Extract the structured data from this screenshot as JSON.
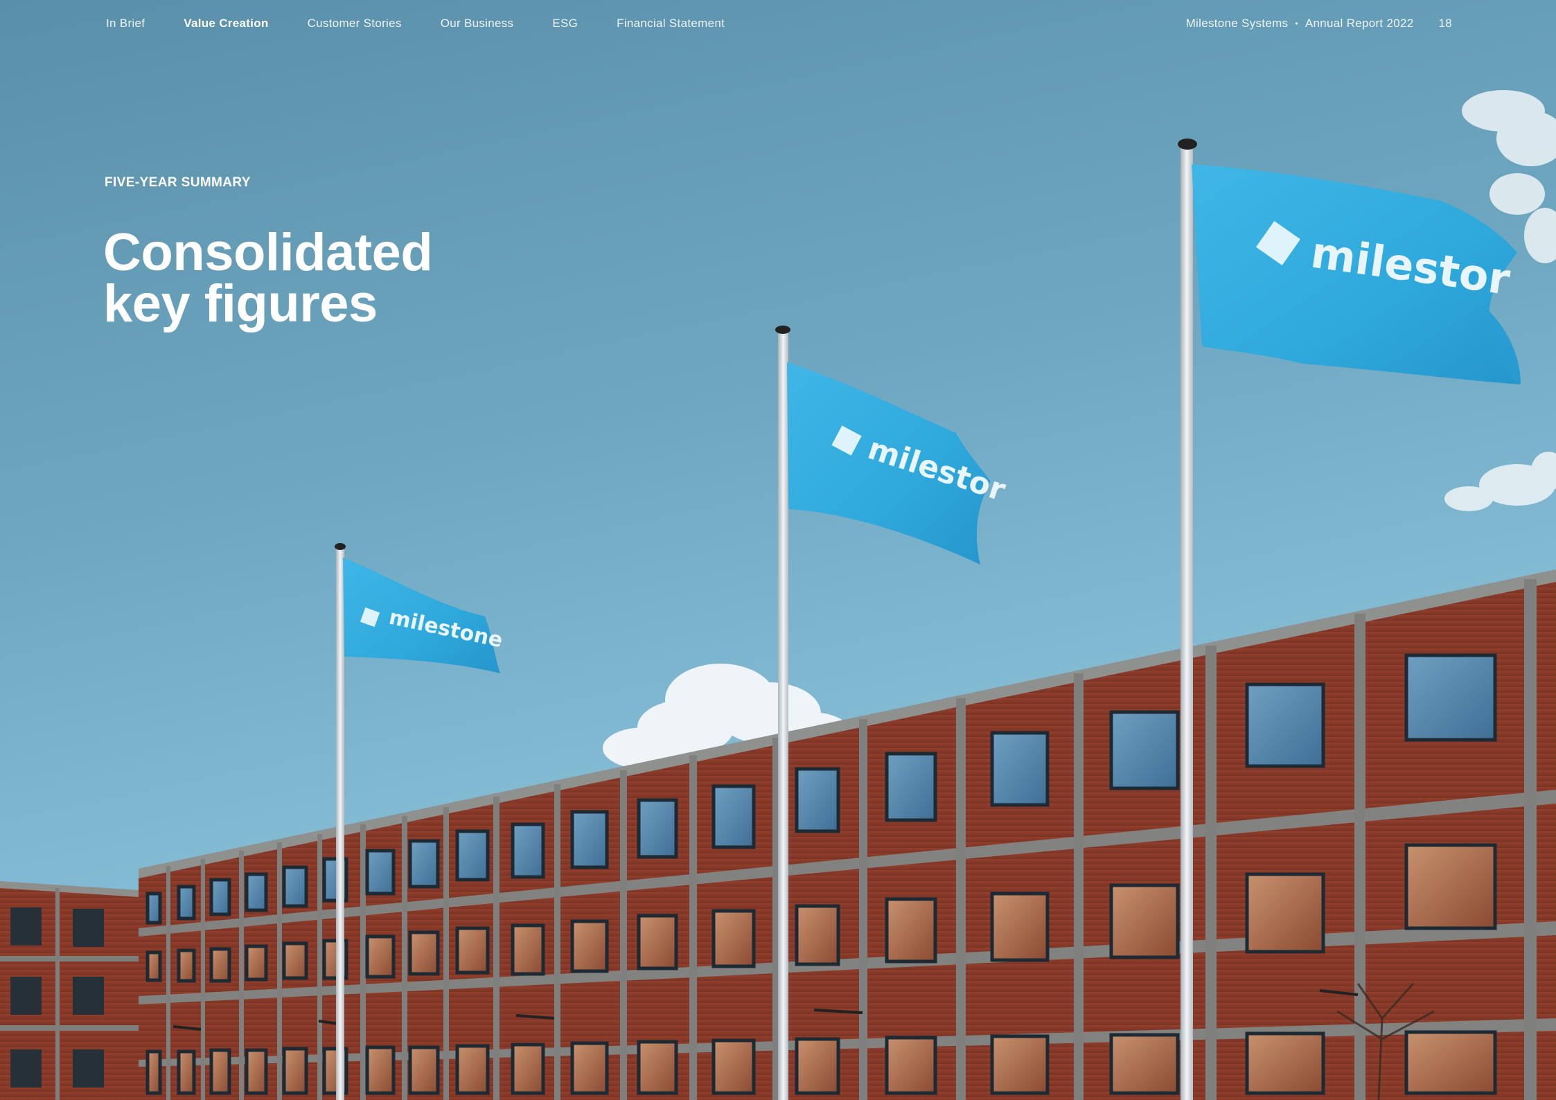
{
  "nav": {
    "items": [
      {
        "label": "In Brief"
      },
      {
        "label": "Value Creation",
        "active": true
      },
      {
        "label": "Customer Stories"
      },
      {
        "label": "Our Business"
      },
      {
        "label": "ESG"
      },
      {
        "label": "Financial Statement"
      }
    ],
    "company": "Milestone Systems",
    "separator": "•",
    "report": "Annual Report 2022",
    "page_number": "18"
  },
  "section": {
    "eyebrow": "FIVE-YEAR SUMMARY",
    "title_line1": "Consolidated",
    "title_line2": "key figures"
  },
  "photo": {
    "flag_text_small": "milestone",
    "flag_text_medium": "milestor",
    "flag_text_large": "milestor",
    "colors": {
      "sky_top": "#5f93ad",
      "sky_bottom": "#8cc4da",
      "flag": "#34aee0",
      "brick": "#8a3a2a",
      "frame": "#7d7d7a"
    }
  }
}
